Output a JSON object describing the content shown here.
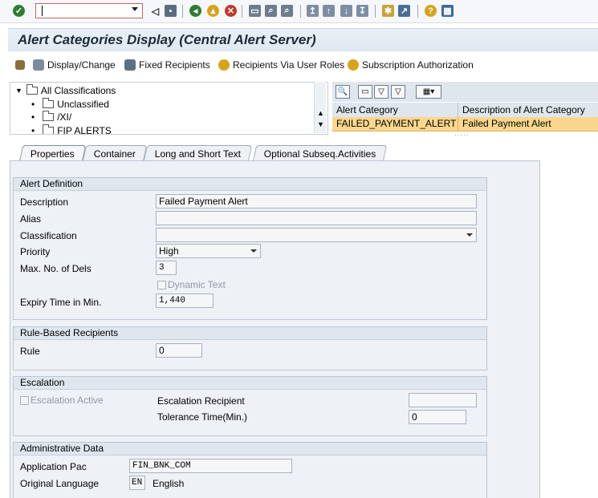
{
  "toolbar": {
    "command_value": "",
    "icons": [
      "enter-icon",
      "back-icon",
      "save-icon",
      "back-green-icon",
      "exit-icon",
      "cancel-icon",
      "print-icon",
      "find-icon",
      "find-next-icon",
      "first-page-icon",
      "prev-page-icon",
      "next-page-icon",
      "last-page-icon",
      "new-session-icon",
      "shortcut-icon",
      "help-icon",
      "layout-icon"
    ]
  },
  "title": "Alert Categories Display (Central Alert Server)",
  "app_toolbar": {
    "display_change": "Display/Change",
    "fixed_recipients": "Fixed Recipients",
    "recipients_via_user_roles": "Recipients Via User Roles",
    "subscription_authorization": "Subscription Authorization"
  },
  "tree": {
    "root": "All Classifications",
    "items": [
      "Unclassified",
      "/XI/",
      "FIP ALERTS"
    ]
  },
  "grid": {
    "headers": [
      "Alert Category",
      "Description of Alert Category"
    ],
    "rows": [
      [
        "FAILED_PAYMENT_ALERT",
        "Failed Payment Alert"
      ]
    ]
  },
  "tabs": [
    "Properties",
    "Container",
    "Long and Short Text",
    "Optional Subseq.Activities"
  ],
  "alert_definition": {
    "title": "Alert Definition",
    "description_label": "Description",
    "description_value": "Failed Payment Alert",
    "alias_label": "Alias",
    "alias_value": "",
    "classification_label": "Classification",
    "classification_value": "",
    "priority_label": "Priority",
    "priority_value": "High",
    "max_dels_label": "Max. No. of Dels",
    "max_dels_value": "3",
    "dynamic_text_label": "Dynamic Text",
    "expiry_label": "Expiry Time in Min.",
    "expiry_value": "1,440"
  },
  "rule_based": {
    "title": "Rule-Based Recipients",
    "rule_label": "Rule",
    "rule_value": "0"
  },
  "escalation": {
    "title": "Escalation",
    "active_label": "Escalation Active",
    "recipient_label": "Escalation Recipient",
    "recipient_value": "",
    "tolerance_label": "Tolerance Time(Min.)",
    "tolerance_value": "0"
  },
  "admin": {
    "title": "Administrative Data",
    "app_pac_label": "Application Pac",
    "app_pac_value": "FIN_BNK_COM",
    "orig_lang_label": "Original Language",
    "orig_lang_code": "EN",
    "orig_lang_name": "English"
  }
}
